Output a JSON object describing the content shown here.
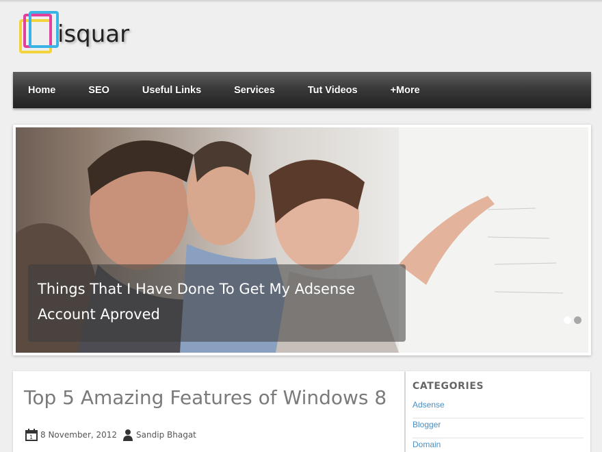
{
  "logo": {
    "text": "isquar"
  },
  "nav": {
    "items": [
      {
        "label": "Home"
      },
      {
        "label": "SEO"
      },
      {
        "label": "Useful Links"
      },
      {
        "label": "Services"
      },
      {
        "label": "Tut Videos"
      },
      {
        "label": "+More"
      }
    ]
  },
  "slider": {
    "caption_line1": "Things That I Have Done To Get My Adsense",
    "caption_line2": "Account Aproved",
    "dots": [
      {
        "state": "active",
        "color": "#ffffff"
      },
      {
        "state": "inactive",
        "color": "#a8a8a8"
      }
    ]
  },
  "post": {
    "title": "Top 5 Amazing Features of Windows 8",
    "date": "8 November, 2012",
    "author": "Sandip Bhagat"
  },
  "sidebar": {
    "title": "CATEGORIES",
    "categories": [
      {
        "label": "Adsense"
      },
      {
        "label": "Blogger"
      },
      {
        "label": "Domain"
      }
    ]
  },
  "colors": {
    "nav_bg": "#3a3a3a",
    "link": "#4a8ec2",
    "post_title": "#7a7a7a",
    "logo_magenta": "#e2409a",
    "logo_cyan": "#3ab4e6",
    "logo_yellow": "#f2d43a"
  }
}
